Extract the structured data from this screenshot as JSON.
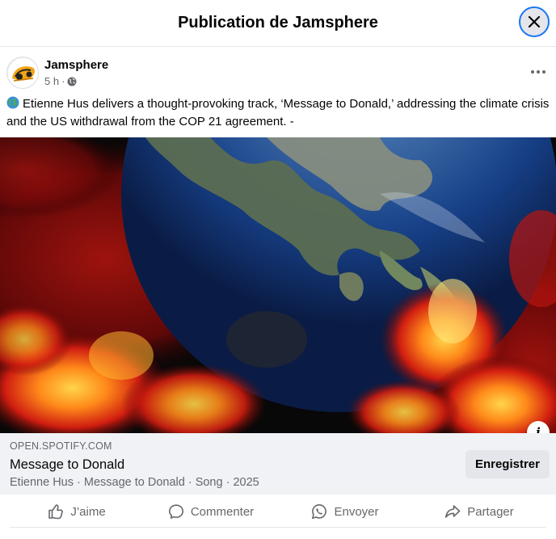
{
  "header": {
    "title": "Publication de Jamsphere",
    "close_icon": "close-icon"
  },
  "post": {
    "author": "Jamsphere",
    "time": "5 h",
    "separator": "·",
    "audience_icon": "globe-icon",
    "text": "Etienne Hus delivers a thought-provoking track, ‘Message to Donald,’ addressing the climate crisis and the US withdrawal from the COP 21 agreement. -"
  },
  "media": {
    "description_icon": "info-icon",
    "info_label": "i"
  },
  "link_card": {
    "domain": "OPEN.SPOTIFY.COM",
    "title": "Message to Donald",
    "description": "Etienne Hus · Message to Donald · Song · 2025",
    "save_label": "Enregistrer"
  },
  "actions": {
    "like": "J’aime",
    "comment": "Commenter",
    "send": "Envoyer",
    "share": "Partager"
  },
  "colors": {
    "accent": "#1877f2",
    "secondary_text": "#65676b",
    "card_bg": "#f0f2f5"
  }
}
